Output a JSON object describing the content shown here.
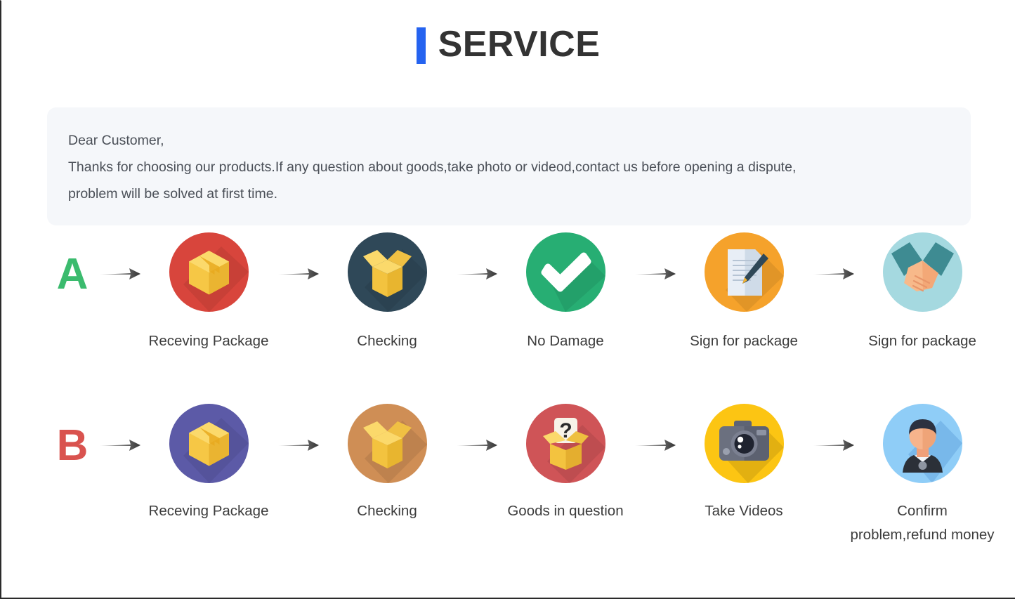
{
  "header": {
    "accent_bar_color": "#2563f0",
    "title": "SERVICE"
  },
  "notice": {
    "background_color": "#f5f7fa",
    "line1": "Dear Customer,",
    "line2": "Thanks for choosing our products.If any question about goods,take photo or videod,contact us before opening a dispute,",
    "line3": "problem will be solved at first time."
  },
  "flows": [
    {
      "letter": "A",
      "letter_color": "#3bbb6e",
      "steps": [
        {
          "label": "Receving Package",
          "icon": "package-box-icon",
          "circle_color": "#d8453c"
        },
        {
          "label": "Checking",
          "icon": "open-box-icon",
          "circle_color": "#2f4858"
        },
        {
          "label": "No Damage",
          "icon": "checkmark-icon",
          "circle_color": "#27ae73"
        },
        {
          "label": "Sign for package",
          "icon": "document-pen-icon",
          "circle_color": "#f5a22b"
        },
        {
          "label": "Sign for package",
          "icon": "handshake-icon",
          "circle_color": "#a5d9e0"
        }
      ]
    },
    {
      "letter": "B",
      "letter_color": "#d9534f",
      "steps": [
        {
          "label": "Receving Package",
          "icon": "package-box-icon",
          "circle_color": "#5c5aa7"
        },
        {
          "label": "Checking",
          "icon": "open-box-icon",
          "circle_color": "#cf8e55"
        },
        {
          "label": "Goods in question",
          "icon": "question-box-icon",
          "circle_color": "#cf5457"
        },
        {
          "label": "Take Videos",
          "icon": "camera-icon",
          "circle_color": "#fcc513"
        },
        {
          "label": "Confirm problem,refund money",
          "icon": "support-person-icon",
          "circle_color": "#8fcdf7"
        }
      ]
    }
  ],
  "arrow": {
    "icon": "arrow-right-icon",
    "color": "#3d3d3d"
  }
}
